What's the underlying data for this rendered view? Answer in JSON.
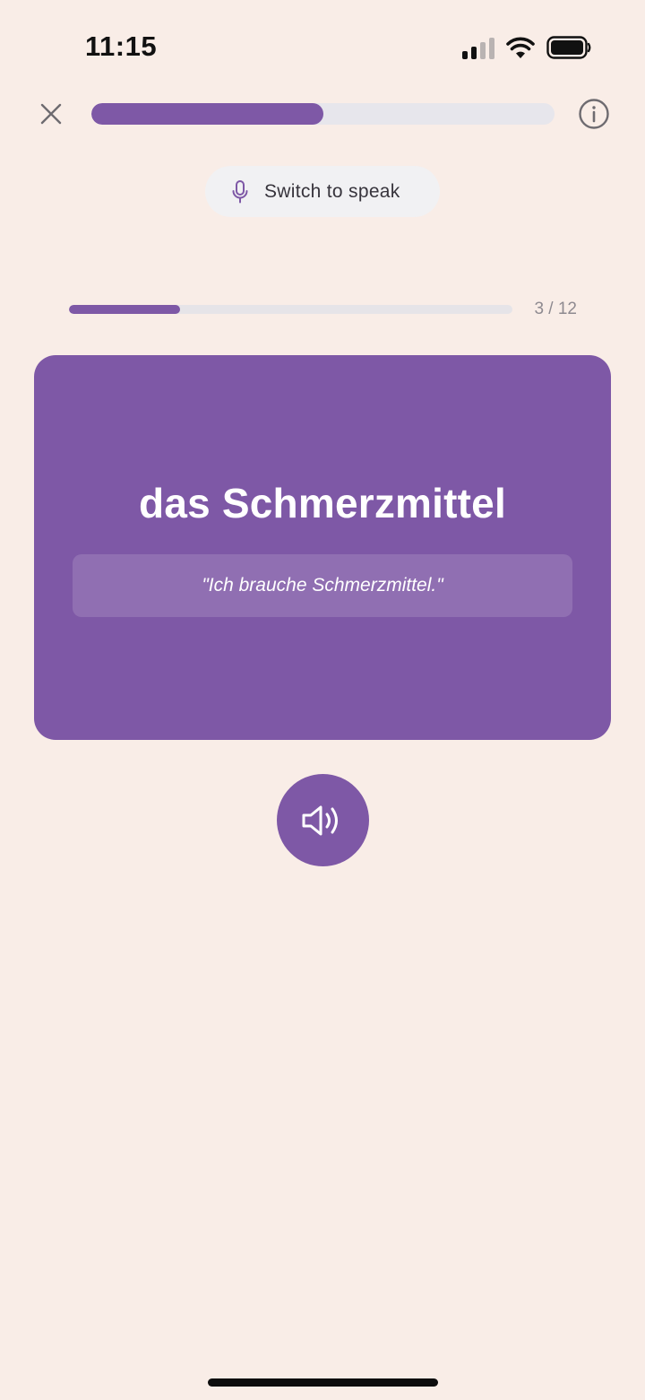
{
  "status_bar": {
    "time": "11:15",
    "signal_icon": "cellular-signal-icon",
    "wifi_icon": "wifi-icon",
    "battery_icon": "battery-icon"
  },
  "top_bar": {
    "close_icon": "close-icon",
    "lesson_progress_fraction": 0.5,
    "info_icon": "info-icon"
  },
  "speak_toggle": {
    "icon": "microphone-icon",
    "label": "Switch to speak"
  },
  "card_progress": {
    "current": 3,
    "total": 12,
    "label": "3 / 12"
  },
  "flashcard": {
    "word": "das Schmerzmittel",
    "example": "\"Ich brauche Schmerzmittel.\""
  },
  "audio_button": {
    "icon": "speaker-icon"
  },
  "colors": {
    "background": "#f9ede7",
    "accent": "#7e58a6",
    "track": "#e7e6ec"
  }
}
